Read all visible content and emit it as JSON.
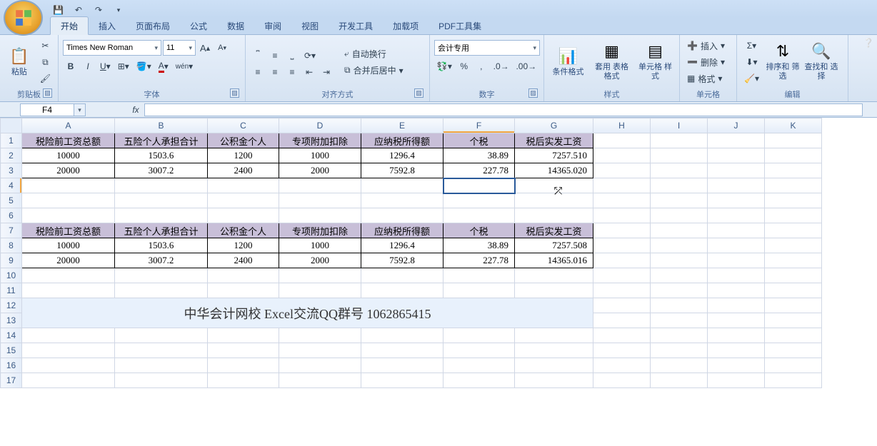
{
  "tabs": [
    "开始",
    "插入",
    "页面布局",
    "公式",
    "数据",
    "审阅",
    "视图",
    "开发工具",
    "加载项",
    "PDF工具集"
  ],
  "active_tab": 0,
  "font": {
    "name": "Times New Roman",
    "size": "11"
  },
  "number_format": "会计专用",
  "groups": {
    "clipboard": "剪贴板",
    "font": "字体",
    "align": "对齐方式",
    "number": "数字",
    "styles": "样式",
    "cells": "单元格",
    "edit": "编辑"
  },
  "btn": {
    "paste": "粘贴",
    "wrap": "自动换行",
    "merge": "合并后居中",
    "condfmt": "条件格式",
    "tablestyle": "套用\n表格格式",
    "cellstyle": "单元格\n样式",
    "insert": "插入",
    "delete": "删除",
    "format": "格式",
    "sort": "排序和\n筛选",
    "find": "查找和\n选择"
  },
  "namebox": "F4",
  "formula": "",
  "cols": [
    "A",
    "B",
    "C",
    "D",
    "E",
    "F",
    "G",
    "H",
    "I",
    "J",
    "K"
  ],
  "row_nums": [
    "1",
    "2",
    "3",
    "4",
    "5",
    "6",
    "7",
    "8",
    "9",
    "10",
    "11",
    "12",
    "13",
    "14",
    "15",
    "16",
    "17"
  ],
  "headers": [
    "税险前工资总额",
    "五险个人承担合计",
    "公积金个人",
    "专项附加扣除",
    "应纳税所得额",
    "个税",
    "税后实发工资"
  ],
  "t1": [
    [
      "10000",
      "1503.6",
      "1200",
      "1000",
      "1296.4",
      "38.89",
      "7257.510"
    ],
    [
      "20000",
      "3007.2",
      "2400",
      "2000",
      "7592.8",
      "227.78",
      "14365.020"
    ]
  ],
  "t2": [
    [
      "10000",
      "1503.6",
      "1200",
      "1000",
      "1296.4",
      "38.89",
      "7257.508"
    ],
    [
      "20000",
      "3007.2",
      "2400",
      "2000",
      "7592.8",
      "227.78",
      "14365.016"
    ]
  ],
  "footer_text": "中华会计网校 Excel交流QQ群号 1062865415",
  "sel": {
    "row": 4,
    "col": "F"
  }
}
